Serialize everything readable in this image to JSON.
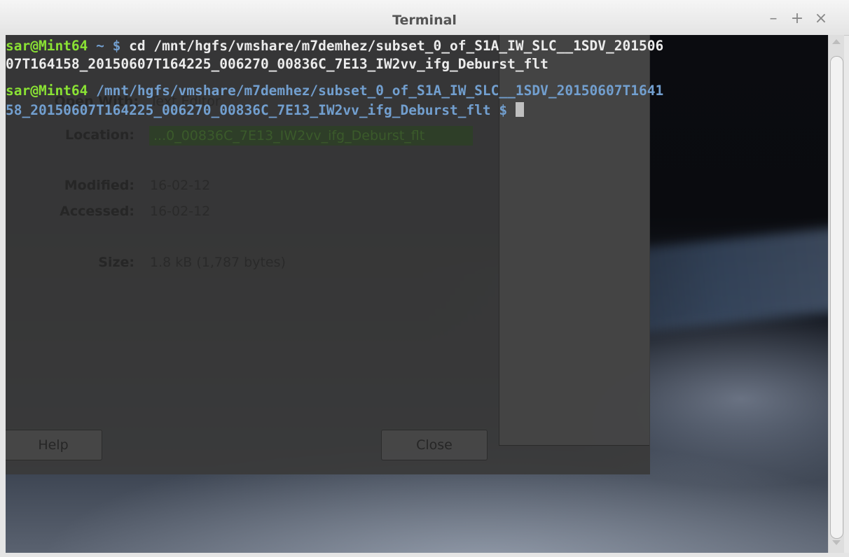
{
  "window": {
    "title": "Terminal",
    "minimize_label": "–",
    "maximize_label": "+",
    "close_label": "×"
  },
  "terminal": {
    "line1_prompt": "sar@Mint64",
    "line1_path": " ~ $ ",
    "line1_cmd": "cd /mnt/hgfs/vmshare/m7demhez/subset_0_of_S1A_IW_SLC__1SDV_201506",
    "line2_cmd": "07T164158_20150607T164225_006270_00836C_7E13_IW2vv_ifg_Deburst_flt",
    "line3_prompt": "sar@Mint64",
    "line3_path": " /mnt/hgfs/vmshare/m7demhez/subset_0_of_S1A_IW_SLC__1SDV_20150607T1641",
    "line4_path": "58_20150607T164225_006270_00836C_7E13_IW2vv_ifg_Deburst_flt $ "
  },
  "background_dialog": {
    "open_with_label": "Open With:",
    "open_with_value": "Text Editor",
    "location_label": "Location:",
    "location_value": "...0_00836C_7E13_IW2vv_ifg_Deburst_flt",
    "modified_label": "Modified:",
    "modified_value": "16-02-12",
    "accessed_label": "Accessed:",
    "accessed_value": "16-02-12",
    "size_label": "Size:",
    "size_value": "1.8 kB (1,787 bytes)",
    "help_button": "Help",
    "close_button": "Close"
  },
  "colors": {
    "prompt_user": "#8ae234",
    "prompt_path": "#729fcf",
    "command_text": "#ececec"
  }
}
